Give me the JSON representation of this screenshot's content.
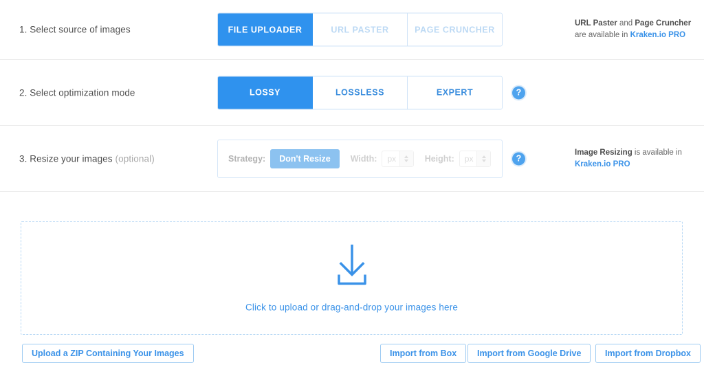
{
  "colors": {
    "accent": "#2f92ee",
    "accent_light": "#8cc2f0",
    "link": "#3a92e8",
    "tab_idle_strong": "#3a8ddd",
    "tab_idle_faded": "#bcd9f4",
    "border_light": "#cfe3f7",
    "dropzone_border": "#b7d8f5",
    "text": "#4d4d4d",
    "muted": "#a8a8a8"
  },
  "steps": [
    {
      "label": "1. Select source of images",
      "tabs": [
        {
          "label": "FILE UPLOADER",
          "state": "active"
        },
        {
          "label": "URL PASTER",
          "state": "disabled"
        },
        {
          "label": "PAGE CRUNCHER",
          "state": "disabled"
        }
      ],
      "promo": {
        "bold1": "URL Paster",
        "mid": " and ",
        "bold2": "Page Cruncher",
        "tail": " are available in ",
        "link": "Kraken.io PRO"
      }
    },
    {
      "label": "2. Select optimization mode",
      "tabs": [
        {
          "label": "LOSSY",
          "state": "active"
        },
        {
          "label": "LOSSLESS",
          "state": "idle"
        },
        {
          "label": "EXPERT",
          "state": "idle"
        }
      ],
      "help_icon": "question-mark-icon",
      "help_glyph": "?"
    },
    {
      "label": "3. Resize your images",
      "label_optional": "(optional)",
      "help_icon": "question-mark-icon",
      "help_glyph": "?",
      "resize": {
        "strategy_label": "Strategy:",
        "strategy_value": "Don't Resize",
        "width_label": "Width:",
        "width_value": "",
        "width_placeholder": "px",
        "height_label": "Height:",
        "height_value": "",
        "height_placeholder": "px"
      },
      "promo": {
        "bold1": "Image Resizing",
        "tail": " is available in ",
        "link": "Kraken.io PRO"
      }
    }
  ],
  "dropzone": {
    "icon": "download-arrow-icon",
    "text": "Click to upload or drag-and-drop your images here"
  },
  "buttons": {
    "zip": "Upload a ZIP Containing Your Images",
    "box": "Import from Box",
    "google_drive": "Import from Google Drive",
    "dropbox": "Import from Dropbox"
  }
}
